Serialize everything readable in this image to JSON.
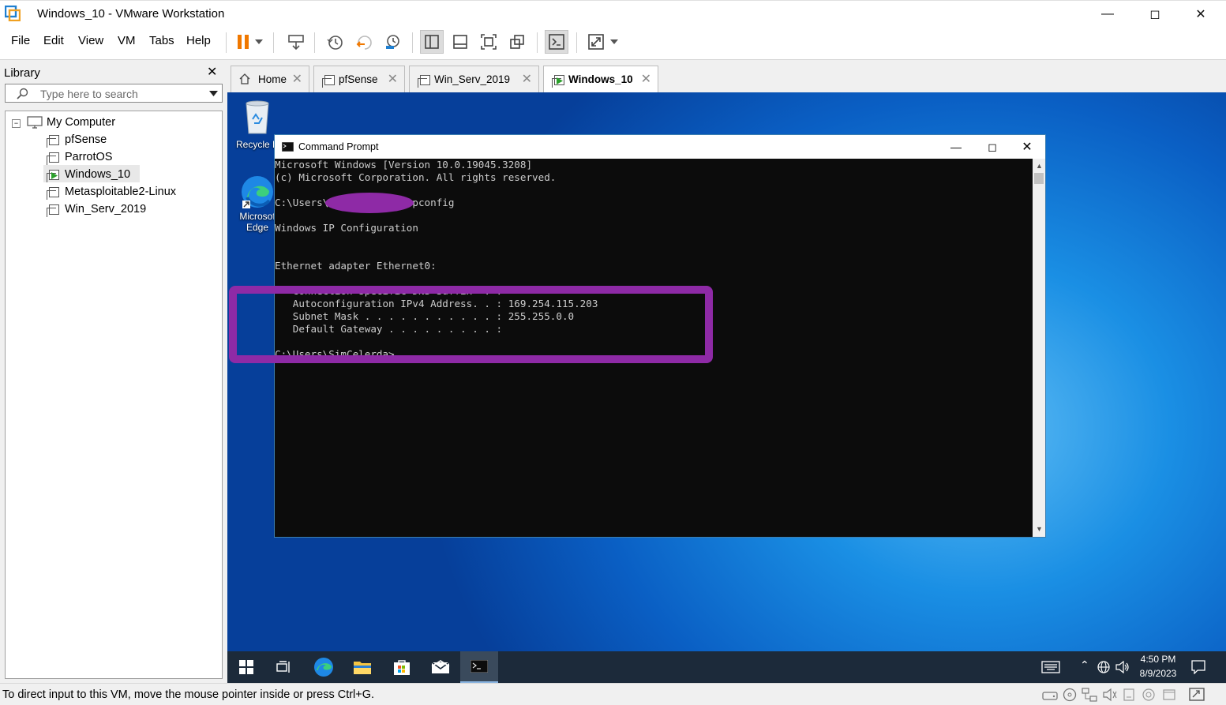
{
  "window": {
    "title": "Windows_10 - VMware Workstation"
  },
  "menu": [
    "File",
    "Edit",
    "View",
    "VM",
    "Tabs",
    "Help"
  ],
  "library": {
    "title": "Library",
    "search_placeholder": "Type here to search",
    "root": "My Computer",
    "items": [
      "pfSense",
      "ParrotOS",
      "Windows_10",
      "Metasploitable2-Linux",
      "Win_Serv_2019"
    ],
    "selected": "Windows_10"
  },
  "tabs": [
    {
      "label": "Home",
      "active": false
    },
    {
      "label": "pfSense",
      "active": false
    },
    {
      "label": "Win_Serv_2019",
      "active": false
    },
    {
      "label": "Windows_10",
      "active": true
    }
  ],
  "desktop": {
    "icons": [
      {
        "label": "Recycle B",
        "icon": "recycle-bin-icon"
      },
      {
        "label": "Microsof\nEdge",
        "icon": "edge-icon"
      }
    ]
  },
  "cmd": {
    "title": "Command Prompt",
    "lines": [
      "Microsoft Windows [Version 10.0.19045.3208]",
      "(c) Microsoft Corporation. All rights reserved.",
      "",
      "C:\\Users\\            >ipconfig",
      "",
      "Windows IP Configuration",
      "",
      "",
      "Ethernet adapter Ethernet0:",
      "",
      "   Connection-specific DNS Suffix  . :",
      "   Autoconfiguration IPv4 Address. . : 169.254.115.203",
      "   Subnet Mask . . . . . . . . . . . : 255.255.0.0",
      "   Default Gateway . . . . . . . . . :",
      "",
      "C:\\Users\\SimCelerda>"
    ]
  },
  "taskbar": {
    "time": "4:50 PM",
    "date": "8/9/2023"
  },
  "status": {
    "text": "To direct input to this VM, move the mouse pointer inside or press Ctrl+G."
  },
  "colors": {
    "highlight": "#8e2aa6",
    "desktop": "#0a5fc4",
    "taskbar": "#1c2a3a"
  }
}
